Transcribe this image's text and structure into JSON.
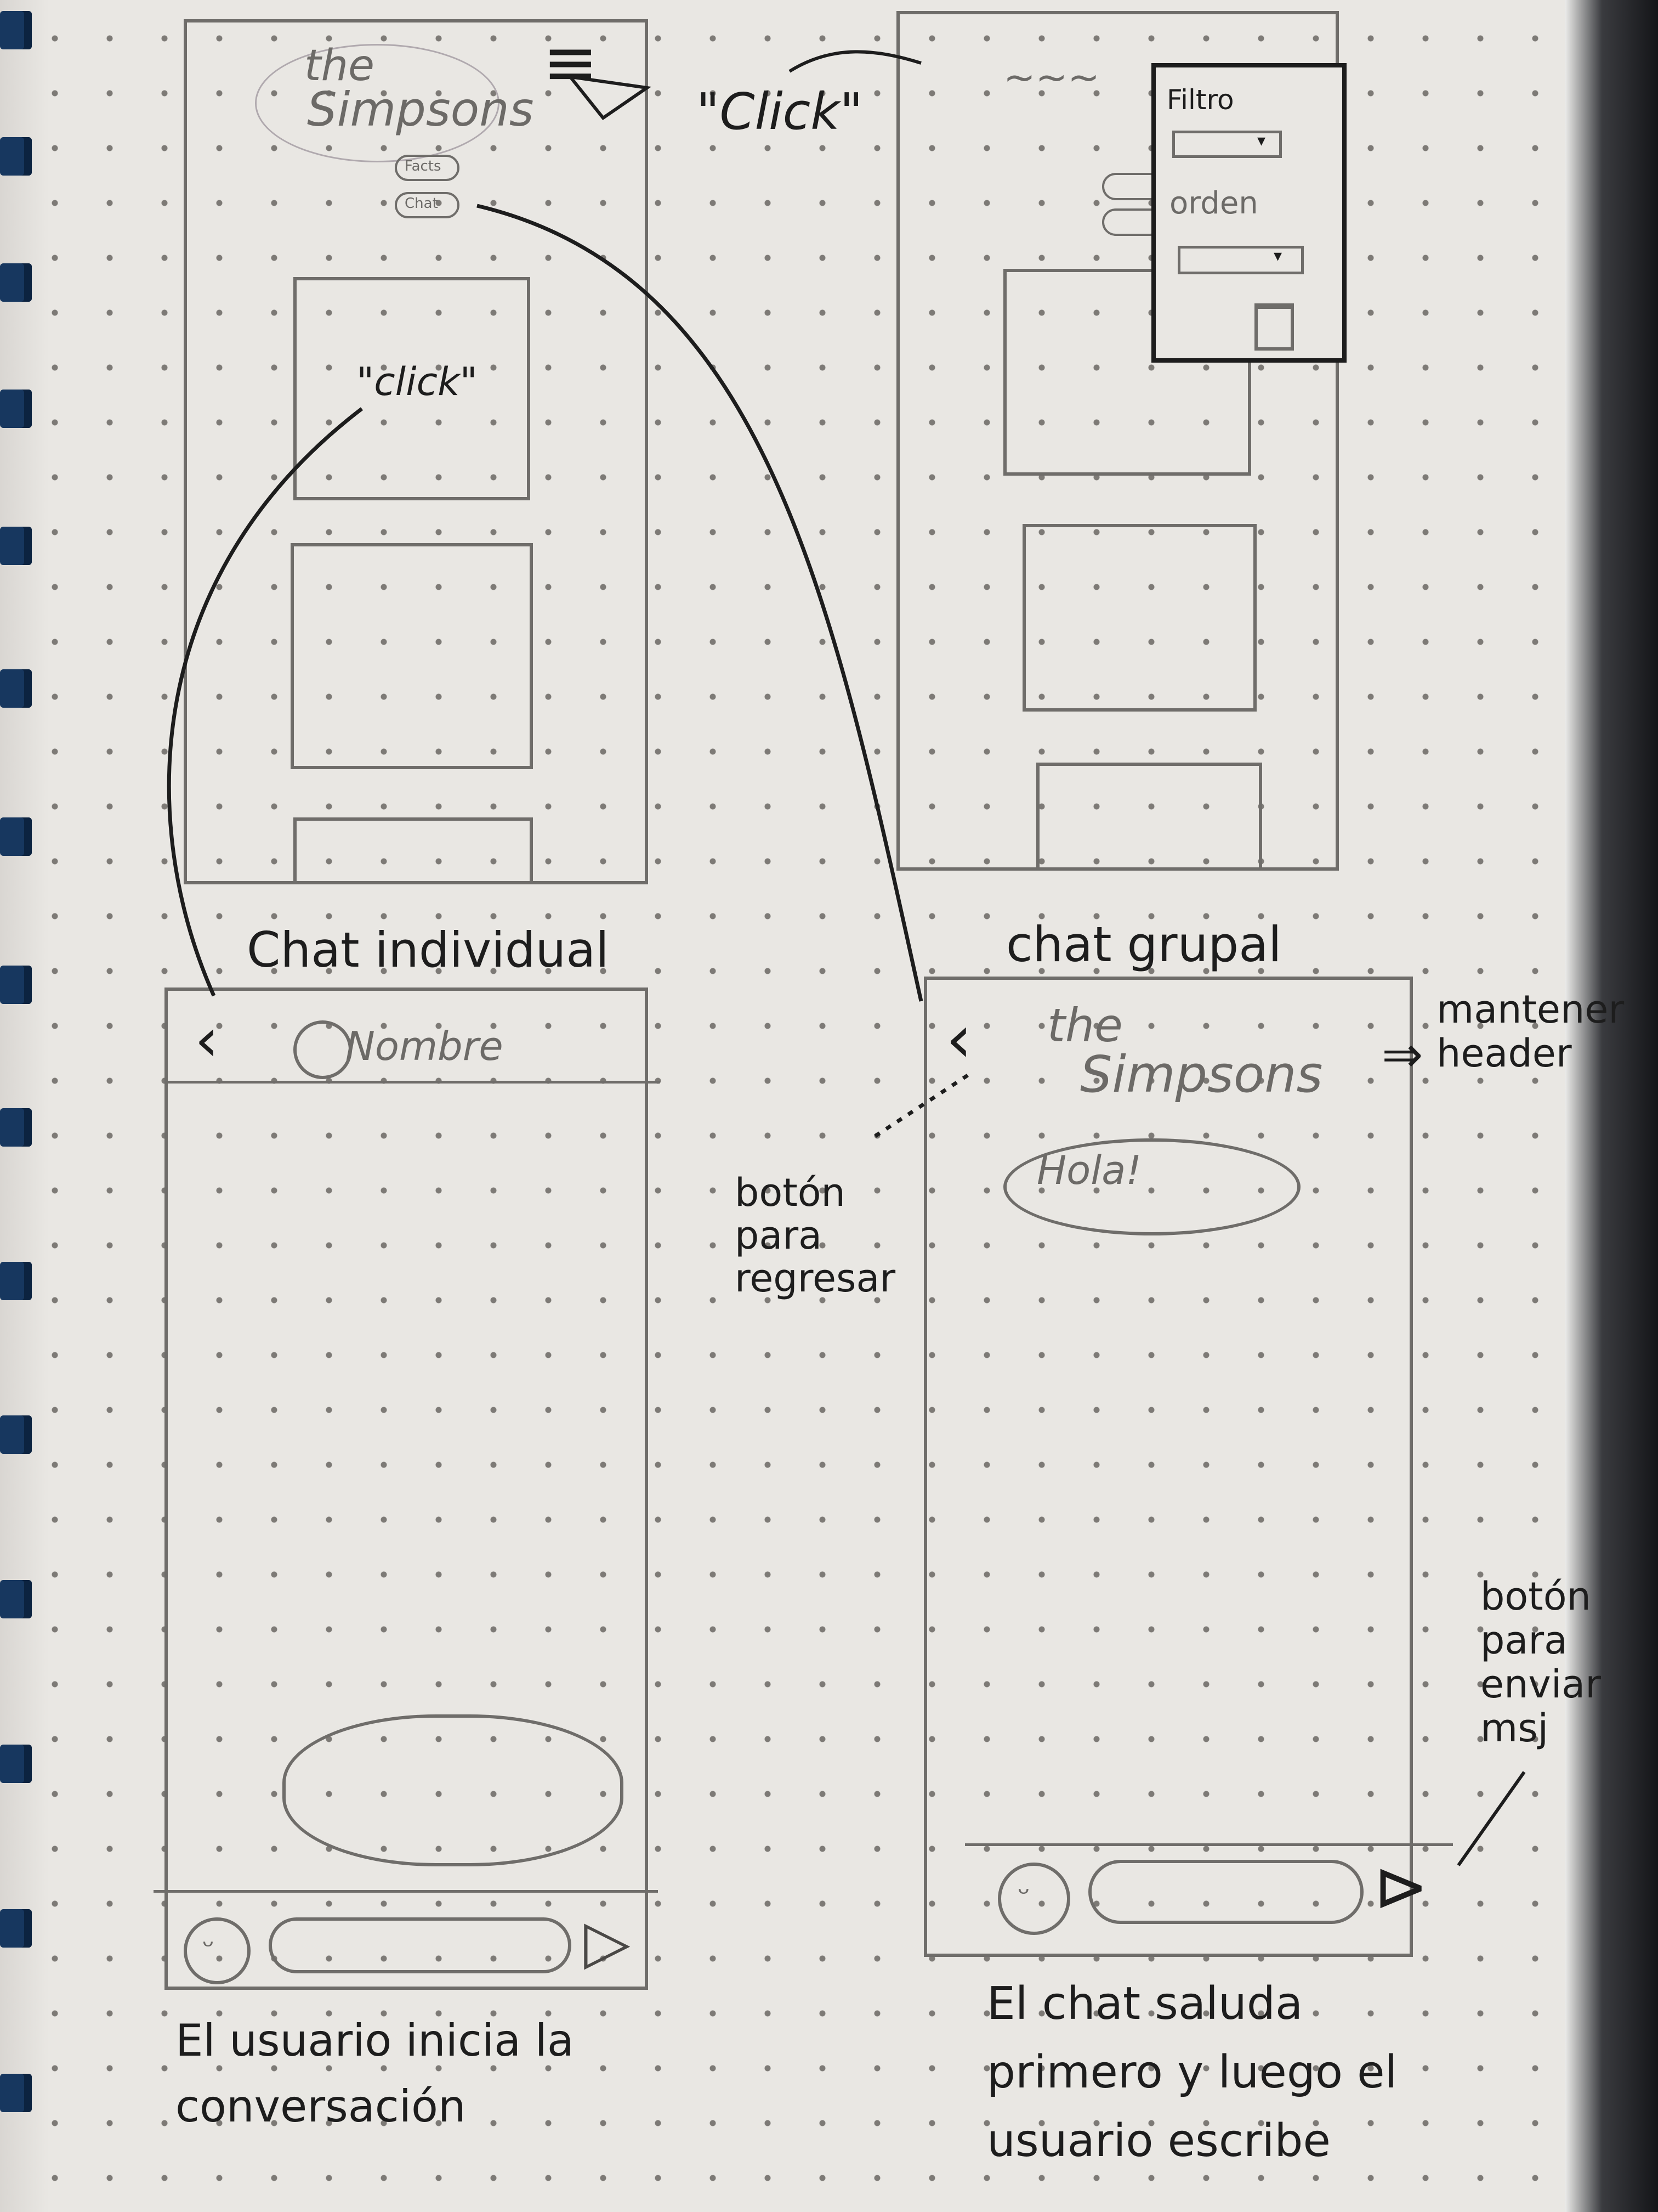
{
  "screen_home": {
    "logo_line1": "the",
    "logo_line2": "Simpsons",
    "button_facts": "Facts",
    "button_chat": "Chat",
    "menu_icon": "hamburger-icon",
    "cursor_icon": "cursor-arrow-icon",
    "annotation_click_menu": "\"Click\"",
    "annotation_click_card": "\"click\""
  },
  "screen_filter": {
    "label_filter": "Filtro",
    "label_order": "orden",
    "trash_icon": "trash-icon"
  },
  "screen_individual": {
    "section_title": "Chat individual",
    "back_icon": "chevron-left-icon",
    "contact_name": "Nombre",
    "caption": "El usuario inicia la conversación",
    "emoji_icon": "smiley-icon",
    "send_icon": "send-icon"
  },
  "screen_group": {
    "section_title": "chat grupal",
    "logo_line1": "the",
    "logo_line2": "Simpsons",
    "greeting": "Hola!",
    "note_header": "mantener header",
    "note_back_button": "botón para regresar",
    "note_send_button": "botón para enviar msj",
    "caption": "El chat saluda primero y luego el usuario escribe",
    "emoji_icon": "smiley-icon",
    "send_icon": "send-icon"
  },
  "colors": {
    "paper": "#e9e7e3",
    "pencil": "#6f6d6a",
    "ink": "#1d1d1d",
    "binding": "#17375f"
  }
}
